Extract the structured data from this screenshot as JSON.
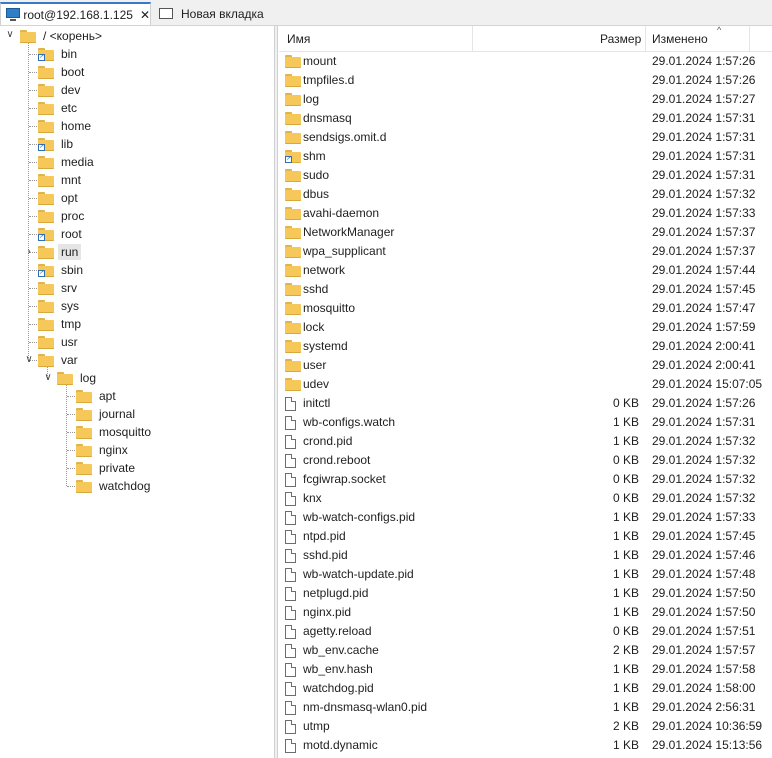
{
  "tabs": [
    {
      "label": "root@192.168.1.125",
      "icon": "terminal-icon",
      "close": "✕"
    },
    {
      "label": "Новая вкладка",
      "icon": "new-tab-icon"
    }
  ],
  "tree": {
    "root_label": "/ <корень>",
    "items": [
      {
        "label": "bin",
        "link": true
      },
      {
        "label": "boot"
      },
      {
        "label": "dev"
      },
      {
        "label": "etc"
      },
      {
        "label": "home"
      },
      {
        "label": "lib",
        "link": true
      },
      {
        "label": "media"
      },
      {
        "label": "mnt"
      },
      {
        "label": "opt"
      },
      {
        "label": "proc"
      },
      {
        "label": "root",
        "link": true
      },
      {
        "label": "run",
        "selected": true
      },
      {
        "label": "sbin",
        "link": true
      },
      {
        "label": "srv"
      },
      {
        "label": "sys"
      },
      {
        "label": "tmp"
      },
      {
        "label": "usr"
      },
      {
        "label": "var",
        "expanded": true
      }
    ],
    "var_children": [
      {
        "label": "log",
        "expanded": true
      }
    ],
    "log_children": [
      {
        "label": "apt"
      },
      {
        "label": "journal"
      },
      {
        "label": "mosquitto"
      },
      {
        "label": "nginx"
      },
      {
        "label": "private"
      },
      {
        "label": "watchdog"
      }
    ]
  },
  "list": {
    "columns": {
      "name": "Имя",
      "size": "Размер",
      "modified": "Изменено"
    },
    "sort_indicator": "^",
    "rows": [
      {
        "name": "mount",
        "type": "folder",
        "size": "",
        "date": "29.01.2024 1:57:26"
      },
      {
        "name": "tmpfiles.d",
        "type": "folder",
        "size": "",
        "date": "29.01.2024 1:57:26"
      },
      {
        "name": "log",
        "type": "folder",
        "size": "",
        "date": "29.01.2024 1:57:27"
      },
      {
        "name": "dnsmasq",
        "type": "folder",
        "size": "",
        "date": "29.01.2024 1:57:31"
      },
      {
        "name": "sendsigs.omit.d",
        "type": "folder",
        "size": "",
        "date": "29.01.2024 1:57:31"
      },
      {
        "name": "shm",
        "type": "folder-link",
        "size": "",
        "date": "29.01.2024 1:57:31"
      },
      {
        "name": "sudo",
        "type": "folder",
        "size": "",
        "date": "29.01.2024 1:57:31"
      },
      {
        "name": "dbus",
        "type": "folder",
        "size": "",
        "date": "29.01.2024 1:57:32"
      },
      {
        "name": "avahi-daemon",
        "type": "folder",
        "size": "",
        "date": "29.01.2024 1:57:33"
      },
      {
        "name": "NetworkManager",
        "type": "folder",
        "size": "",
        "date": "29.01.2024 1:57:37"
      },
      {
        "name": "wpa_supplicant",
        "type": "folder",
        "size": "",
        "date": "29.01.2024 1:57:37"
      },
      {
        "name": "network",
        "type": "folder",
        "size": "",
        "date": "29.01.2024 1:57:44"
      },
      {
        "name": "sshd",
        "type": "folder",
        "size": "",
        "date": "29.01.2024 1:57:45"
      },
      {
        "name": "mosquitto",
        "type": "folder",
        "size": "",
        "date": "29.01.2024 1:57:47"
      },
      {
        "name": "lock",
        "type": "folder",
        "size": "",
        "date": "29.01.2024 1:57:59"
      },
      {
        "name": "systemd",
        "type": "folder",
        "size": "",
        "date": "29.01.2024 2:00:41"
      },
      {
        "name": "user",
        "type": "folder",
        "size": "",
        "date": "29.01.2024 2:00:41"
      },
      {
        "name": "udev",
        "type": "folder",
        "size": "",
        "date": "29.01.2024 15:07:05"
      },
      {
        "name": "initctl",
        "type": "file",
        "size": "0 KB",
        "date": "29.01.2024 1:57:26"
      },
      {
        "name": "wb-configs.watch",
        "type": "file",
        "size": "1 KB",
        "date": "29.01.2024 1:57:31"
      },
      {
        "name": "crond.pid",
        "type": "file",
        "size": "1 KB",
        "date": "29.01.2024 1:57:32"
      },
      {
        "name": "crond.reboot",
        "type": "file",
        "size": "0 KB",
        "date": "29.01.2024 1:57:32"
      },
      {
        "name": "fcgiwrap.socket",
        "type": "file",
        "size": "0 KB",
        "date": "29.01.2024 1:57:32"
      },
      {
        "name": "knx",
        "type": "file",
        "size": "0 KB",
        "date": "29.01.2024 1:57:32"
      },
      {
        "name": "wb-watch-configs.pid",
        "type": "file",
        "size": "1 KB",
        "date": "29.01.2024 1:57:33"
      },
      {
        "name": "ntpd.pid",
        "type": "file",
        "size": "1 KB",
        "date": "29.01.2024 1:57:45"
      },
      {
        "name": "sshd.pid",
        "type": "file",
        "size": "1 KB",
        "date": "29.01.2024 1:57:46"
      },
      {
        "name": "wb-watch-update.pid",
        "type": "file",
        "size": "1 KB",
        "date": "29.01.2024 1:57:48"
      },
      {
        "name": "netplugd.pid",
        "type": "file",
        "size": "1 KB",
        "date": "29.01.2024 1:57:50"
      },
      {
        "name": "nginx.pid",
        "type": "file",
        "size": "1 KB",
        "date": "29.01.2024 1:57:50"
      },
      {
        "name": "agetty.reload",
        "type": "file",
        "size": "0 KB",
        "date": "29.01.2024 1:57:51"
      },
      {
        "name": "wb_env.cache",
        "type": "file",
        "size": "2 KB",
        "date": "29.01.2024 1:57:57"
      },
      {
        "name": "wb_env.hash",
        "type": "file",
        "size": "1 KB",
        "date": "29.01.2024 1:57:58"
      },
      {
        "name": "watchdog.pid",
        "type": "file",
        "size": "1 KB",
        "date": "29.01.2024 1:58:00"
      },
      {
        "name": "nm-dnsmasq-wlan0.pid",
        "type": "file",
        "size": "1 KB",
        "date": "29.01.2024 2:56:31"
      },
      {
        "name": "utmp",
        "type": "file",
        "size": "2 KB",
        "date": "29.01.2024 10:36:59"
      },
      {
        "name": "motd.dynamic",
        "type": "file",
        "size": "1 KB",
        "date": "29.01.2024 15:13:56"
      }
    ]
  }
}
